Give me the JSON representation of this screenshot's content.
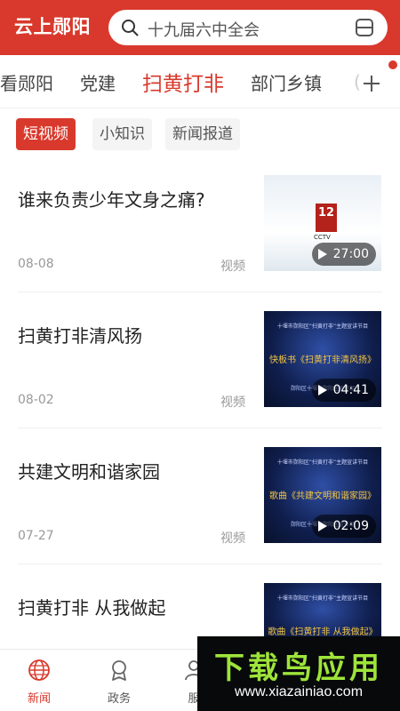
{
  "header": {
    "brand": "云上郧阳",
    "search_placeholder": "十九届六中全会"
  },
  "tabs": {
    "items": [
      "看郧阳",
      "党建",
      "扫黄打非",
      "部门乡镇"
    ],
    "active": "扫黄打非",
    "partial": "(",
    "add_icon": "plus-icon"
  },
  "subtabs": {
    "items": [
      "短视频",
      "小知识",
      "新闻报道"
    ],
    "active": "短视频"
  },
  "news": [
    {
      "title": "谁来负责少年文身之痛?",
      "date": "08-08",
      "type": "视频",
      "duration": "27:00",
      "thumb_logo": "12",
      "thumb_caption": "CCTV"
    },
    {
      "title": "扫黄打非清风扬",
      "date": "08-02",
      "type": "视频",
      "duration": "04:41",
      "thumb_line1": "十堰市郧阳区“扫黄打非”主题宣讲节目",
      "thumb_line2": "快板书《扫黄打非清风扬》",
      "thumb_line3": "郧阳区十堰市郧阳区宣传部"
    },
    {
      "title": "共建文明和谐家园",
      "date": "07-27",
      "type": "视频",
      "duration": "02:09",
      "thumb_line1": "十堰市郧阳区“扫黄打非”主题宣讲节目",
      "thumb_line2": "歌曲《共建文明和谐家园》",
      "thumb_line3": "郧阳区十堰市郧阳区宣传部"
    },
    {
      "title": "扫黄打非 从我做起",
      "thumb_line1": "十堰市郧阳区“扫黄打非”主题宣讲节目",
      "thumb_line2": "歌曲《扫黄打非 从我做起》"
    }
  ],
  "bottom_nav": {
    "items": [
      {
        "label": "新闻",
        "icon": "globe-icon",
        "active": true
      },
      {
        "label": "政务",
        "icon": "badge-icon",
        "active": false
      },
      {
        "label": "服",
        "icon": "service-icon",
        "active": false
      }
    ]
  },
  "watermark": {
    "title": "下载鸟应用",
    "url": "www.xiazainiao.com"
  },
  "colors": {
    "accent": "#d8392c",
    "muted": "#999999",
    "watermark_green": "#9ee43a"
  }
}
